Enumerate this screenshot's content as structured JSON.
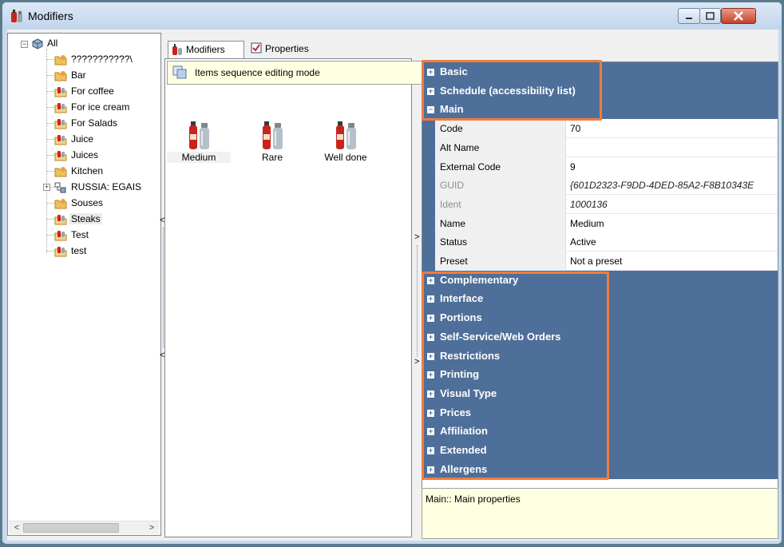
{
  "window": {
    "title": "Modifiers"
  },
  "tree": {
    "root": "All",
    "items": [
      {
        "label": "???????????\\",
        "kind": "folder"
      },
      {
        "label": "Bar",
        "kind": "folder"
      },
      {
        "label": "For coffee",
        "kind": "group"
      },
      {
        "label": "For ice cream",
        "kind": "group"
      },
      {
        "label": "For Salads",
        "kind": "group"
      },
      {
        "label": "Juice",
        "kind": "group"
      },
      {
        "label": "Juices",
        "kind": "group"
      },
      {
        "label": "Kitchen",
        "kind": "folder"
      },
      {
        "label": "RUSSIA: EGAIS",
        "kind": "special"
      },
      {
        "label": "Souses",
        "kind": "folder"
      },
      {
        "label": "Steaks",
        "kind": "group",
        "selected": true
      },
      {
        "label": "Test",
        "kind": "group"
      },
      {
        "label": "test",
        "kind": "group"
      }
    ]
  },
  "tabs": [
    {
      "label": "Modifiers",
      "active": true
    },
    {
      "label": "Properties",
      "active": false
    }
  ],
  "middle": {
    "sequence_mode": "Items sequence editing mode",
    "items": [
      {
        "label": "Medium",
        "selected": true
      },
      {
        "label": "Rare",
        "selected": false
      },
      {
        "label": "Well done",
        "selected": false
      }
    ]
  },
  "grid": {
    "top_categories": [
      {
        "label": "Basic",
        "expanded": false
      },
      {
        "label": "Schedule (accessibility list)",
        "expanded": false
      },
      {
        "label": "Main",
        "expanded": true
      }
    ],
    "main_properties": [
      {
        "name": "Code",
        "value": "70",
        "readonly": false
      },
      {
        "name": "Alt Name",
        "value": "",
        "readonly": false
      },
      {
        "name": "External Code",
        "value": "9",
        "readonly": false
      },
      {
        "name": "GUID",
        "value": "{601D2323-F9DD-4DED-85A2-F8B10343E",
        "readonly": true
      },
      {
        "name": "Ident",
        "value": "1000136",
        "readonly": true
      },
      {
        "name": "Name",
        "value": "Medium",
        "readonly": false
      },
      {
        "name": "Status",
        "value": "Active",
        "readonly": false
      },
      {
        "name": "Preset",
        "value": "Not a preset",
        "readonly": false
      }
    ],
    "bottom_categories": [
      {
        "label": "Complementary"
      },
      {
        "label": "Interface"
      },
      {
        "label": "Portions"
      },
      {
        "label": "Self-Service/Web Orders"
      },
      {
        "label": "Restrictions"
      },
      {
        "label": "Printing"
      },
      {
        "label": "Visual Type"
      },
      {
        "label": "Prices"
      },
      {
        "label": "Affiliation"
      },
      {
        "label": "Extended"
      },
      {
        "label": "Allergens"
      }
    ],
    "description": "Main:: Main properties"
  },
  "colors": {
    "category_bg": "#4e6f99",
    "highlight": "#ef7d3c",
    "info_bg": "#ffffe1"
  },
  "icons": {
    "tree_folder": "folder-icon",
    "tree_group": "group-icon",
    "item": "ketchup-bottle-icon"
  }
}
